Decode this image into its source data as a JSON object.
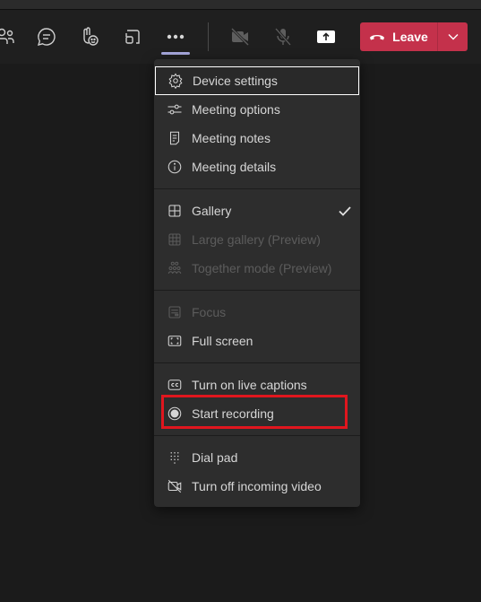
{
  "toolbar": {
    "buttons": [
      {
        "name": "participants",
        "icon": "people-icon"
      },
      {
        "name": "chat",
        "icon": "chat-icon"
      },
      {
        "name": "reactions",
        "icon": "raise-hand-icon"
      },
      {
        "name": "rooms",
        "icon": "breakout-rooms-icon"
      },
      {
        "name": "more-actions",
        "icon": "more-icon",
        "active": true
      },
      {
        "name": "camera",
        "icon": "camera-off-icon",
        "state": "off"
      },
      {
        "name": "mic",
        "icon": "mic-off-icon",
        "state": "off"
      },
      {
        "name": "share",
        "icon": "share-screen-icon"
      }
    ],
    "leave": {
      "label": "Leave",
      "icon": "phone-hangup-icon",
      "color": "#c4314b"
    }
  },
  "menu": {
    "sections": [
      {
        "items": [
          {
            "label": "Device settings",
            "icon": "gear-icon",
            "focused": true
          },
          {
            "label": "Meeting options",
            "icon": "sliders-icon"
          },
          {
            "label": "Meeting notes",
            "icon": "notes-icon"
          },
          {
            "label": "Meeting details",
            "icon": "info-icon"
          }
        ]
      },
      {
        "items": [
          {
            "label": "Gallery",
            "icon": "gallery-icon",
            "checked": true
          },
          {
            "label": "Large gallery (Preview)",
            "icon": "large-gallery-icon",
            "disabled": true
          },
          {
            "label": "Together mode (Preview)",
            "icon": "together-mode-icon",
            "disabled": true
          }
        ]
      },
      {
        "items": [
          {
            "label": "Focus",
            "icon": "focus-icon",
            "disabled": true
          },
          {
            "label": "Full screen",
            "icon": "fullscreen-icon"
          }
        ]
      },
      {
        "items": [
          {
            "label": "Turn on live captions",
            "icon": "cc-icon"
          },
          {
            "label": "Start recording",
            "icon": "record-icon",
            "highlighted": true
          }
        ]
      },
      {
        "items": [
          {
            "label": "Dial pad",
            "icon": "dialpad-icon"
          },
          {
            "label": "Turn off incoming video",
            "icon": "video-off-icon"
          }
        ]
      }
    ]
  },
  "colors": {
    "accent": "#a6a7dc",
    "leave": "#c4314b",
    "highlight": "#e0161e"
  }
}
